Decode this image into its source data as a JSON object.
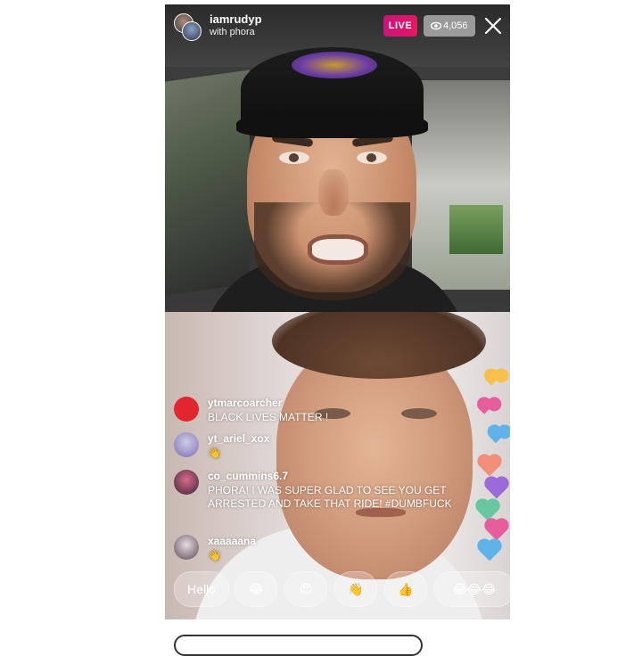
{
  "header": {
    "host_username": "iamrudyp",
    "with_text": "with phora",
    "live_label": "LIVE",
    "viewer_count": "4,056"
  },
  "comments": [
    {
      "username": "ytmarcoarcher",
      "text": "BLACK LIVES MATTER !"
    },
    {
      "username": "yt_ariel_xox",
      "text": "👋"
    },
    {
      "username": "co_cummins6.7",
      "text": "PHORA! I WAS SUPER GLAD TO SEE YOU GET ARRESTED AND TAKE THAT RIDE! #DUMBFUCK"
    },
    {
      "username": "xaaaaana",
      "text": "👋"
    }
  ],
  "quick_reactions": {
    "hello_label": "Hello",
    "emojis": [
      "😂",
      "😍",
      "👋",
      "👍",
      "😂😂😂"
    ]
  },
  "colors": {
    "live_badge": "#e7185e",
    "heart_colors": [
      "#f7c04a",
      "#e85d9c",
      "#5fb3e8",
      "#9b6cd9",
      "#66c7a0",
      "#f28e7a"
    ]
  },
  "icons": {
    "close": "close-icon",
    "viewer": "eye-icon"
  }
}
